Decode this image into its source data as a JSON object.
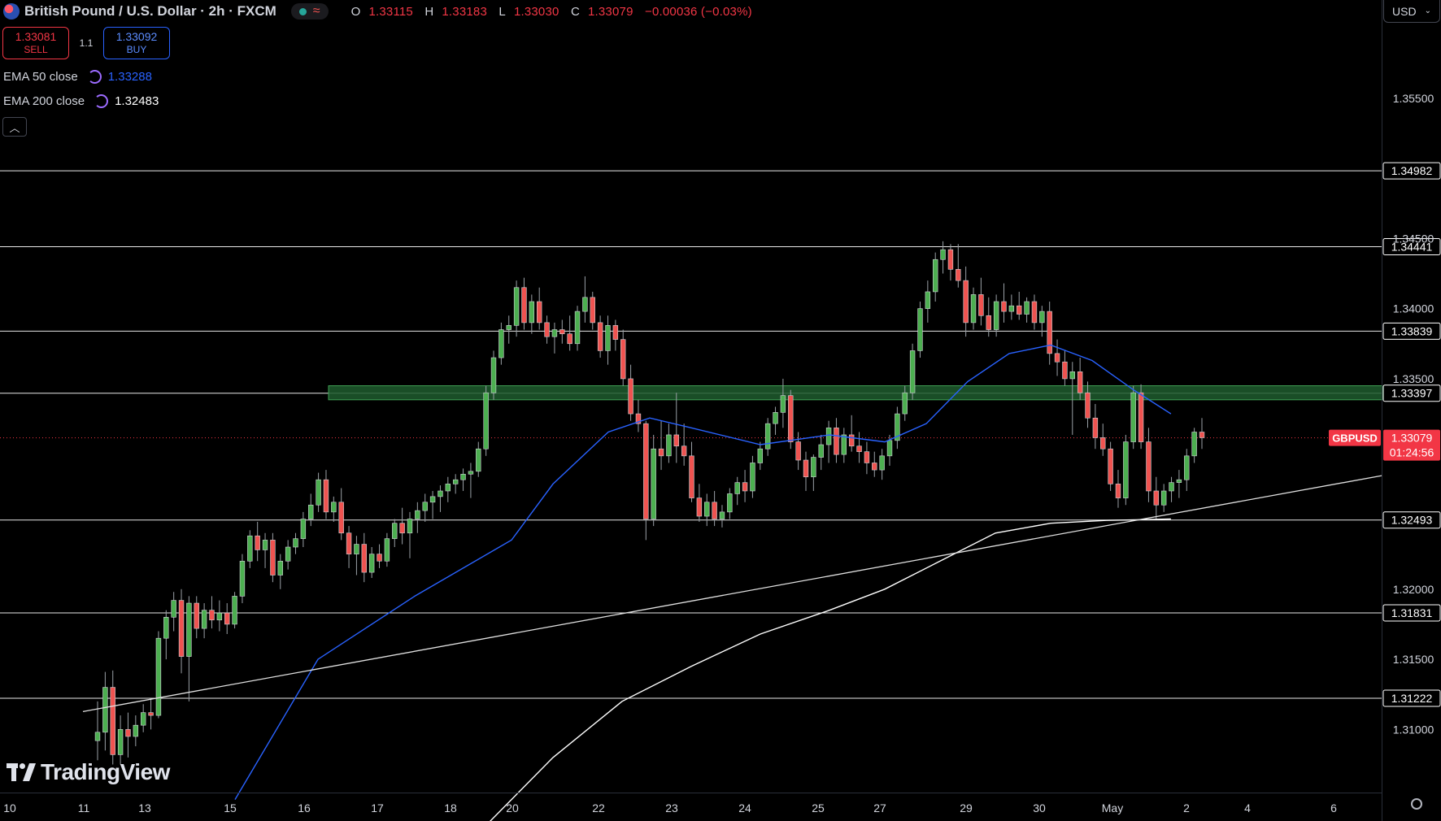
{
  "header": {
    "symbol_title": "British Pound / U.S. Dollar · 2h · FXCM",
    "open": "1.33115",
    "high": "1.33183",
    "low": "1.33030",
    "close": "1.33079",
    "change": "−0.00036 (−0.03%)"
  },
  "trade": {
    "sell_price": "1.33081",
    "sell_label": "SELL",
    "spread": "1.1",
    "buy_price": "1.33092",
    "buy_label": "BUY"
  },
  "indicators": [
    {
      "label": "EMA 50 close",
      "value": "1.33288",
      "color": "#2962ff"
    },
    {
      "label": "EMA 200 close",
      "value": "1.32483",
      "color": "#ffffff"
    }
  ],
  "currency": "USD",
  "branding": "TradingView",
  "chart_data": {
    "type": "candlestick",
    "title": "British Pound / U.S. Dollar · 2h · FXCM",
    "ylim": [
      1.3055,
      1.362
    ],
    "y_ticks": [
      "1.35500",
      "1.34500",
      "1.34000",
      "1.33500",
      "1.32000",
      "1.31500",
      "1.31000"
    ],
    "x_tick_labels": [
      "10",
      "11",
      "13",
      "15",
      "16",
      "17",
      "18",
      "20",
      "22",
      "23",
      "24",
      "25",
      "27",
      "29",
      "30",
      "May",
      "2",
      "4",
      "6"
    ],
    "horizontal_levels": [
      "1.34982",
      "1.34441",
      "1.33839",
      "1.33397",
      "1.32493",
      "1.31831",
      "1.31222"
    ],
    "current_price": {
      "symbol": "GBPUSD",
      "price": "1.33079",
      "countdown": "01:24:56",
      "value": 1.33079
    },
    "resistance_zone": [
      1.3335,
      1.3345
    ],
    "trendline": [
      [
        1.3102,
        0.0
      ],
      [
        1.3281,
        1.0
      ]
    ],
    "ema50": [
      [
        0.17,
        1.305
      ],
      [
        0.23,
        1.315
      ],
      [
        0.3,
        1.3195
      ],
      [
        0.37,
        1.3235
      ],
      [
        0.4,
        1.3275
      ],
      [
        0.44,
        1.3312
      ],
      [
        0.47,
        1.3322
      ],
      [
        0.5,
        1.3315
      ],
      [
        0.55,
        1.3303
      ],
      [
        0.6,
        1.331
      ],
      [
        0.64,
        1.3305
      ],
      [
        0.67,
        1.3318
      ],
      [
        0.7,
        1.3348
      ],
      [
        0.73,
        1.3368
      ],
      [
        0.76,
        1.3374
      ],
      [
        0.79,
        1.3363
      ],
      [
        0.82,
        1.3342
      ],
      [
        0.847,
        1.3325
      ]
    ],
    "ema200": [
      [
        0.35,
        1.303
      ],
      [
        0.4,
        1.308
      ],
      [
        0.45,
        1.312
      ],
      [
        0.5,
        1.3145
      ],
      [
        0.55,
        1.3168
      ],
      [
        0.6,
        1.3185
      ],
      [
        0.64,
        1.32
      ],
      [
        0.68,
        1.322
      ],
      [
        0.72,
        1.324
      ],
      [
        0.76,
        1.3247
      ],
      [
        0.8,
        1.3249
      ],
      [
        0.847,
        1.325
      ]
    ],
    "candles": [
      [
        1.3092,
        1.312,
        1.3078,
        1.3098
      ],
      [
        1.3098,
        1.3141,
        1.3085,
        1.313
      ],
      [
        1.313,
        1.3142,
        1.3075,
        1.3082
      ],
      [
        1.3082,
        1.311,
        1.3075,
        1.31
      ],
      [
        1.31,
        1.3112,
        1.308,
        1.3095
      ],
      [
        1.3095,
        1.311,
        1.3088,
        1.3103
      ],
      [
        1.3103,
        1.3118,
        1.3098,
        1.3112
      ],
      [
        1.3112,
        1.3122,
        1.31,
        1.311
      ],
      [
        1.311,
        1.317,
        1.3108,
        1.3165
      ],
      [
        1.3165,
        1.3185,
        1.315,
        1.318
      ],
      [
        1.318,
        1.3198,
        1.317,
        1.3192
      ],
      [
        1.3192,
        1.32,
        1.314,
        1.3152
      ],
      [
        1.3152,
        1.3195,
        1.312,
        1.319
      ],
      [
        1.319,
        1.3195,
        1.3165,
        1.3172
      ],
      [
        1.3172,
        1.319,
        1.3165,
        1.3185
      ],
      [
        1.3185,
        1.3195,
        1.3172,
        1.3178
      ],
      [
        1.3178,
        1.3192,
        1.317,
        1.3183
      ],
      [
        1.3183,
        1.319,
        1.3168,
        1.3175
      ],
      [
        1.3175,
        1.3198,
        1.3172,
        1.3195
      ],
      [
        1.3195,
        1.3225,
        1.319,
        1.322
      ],
      [
        1.322,
        1.3242,
        1.3215,
        1.3238
      ],
      [
        1.3238,
        1.3248,
        1.322,
        1.3228
      ],
      [
        1.3228,
        1.324,
        1.3215,
        1.3235
      ],
      [
        1.3235,
        1.324,
        1.3205,
        1.321
      ],
      [
        1.321,
        1.3225,
        1.32,
        1.322
      ],
      [
        1.322,
        1.3235,
        1.3214,
        1.323
      ],
      [
        1.323,
        1.324,
        1.3225,
        1.3236
      ],
      [
        1.3236,
        1.3255,
        1.323,
        1.325
      ],
      [
        1.325,
        1.3268,
        1.3245,
        1.326
      ],
      [
        1.326,
        1.3283,
        1.3255,
        1.3278
      ],
      [
        1.3278,
        1.3285,
        1.325,
        1.3255
      ],
      [
        1.3255,
        1.3266,
        1.3248,
        1.3262
      ],
      [
        1.3262,
        1.3272,
        1.3235,
        1.324
      ],
      [
        1.324,
        1.3245,
        1.3215,
        1.3225
      ],
      [
        1.3225,
        1.3238,
        1.321,
        1.3232
      ],
      [
        1.3232,
        1.324,
        1.3205,
        1.3212
      ],
      [
        1.3212,
        1.323,
        1.3208,
        1.3225
      ],
      [
        1.3225,
        1.3232,
        1.3215,
        1.322
      ],
      [
        1.322,
        1.324,
        1.3216,
        1.3236
      ],
      [
        1.3236,
        1.325,
        1.323,
        1.3247
      ],
      [
        1.3247,
        1.3258,
        1.3232,
        1.324
      ],
      [
        1.324,
        1.3255,
        1.3222,
        1.325
      ],
      [
        1.325,
        1.3262,
        1.324,
        1.3256
      ],
      [
        1.3256,
        1.3268,
        1.3248,
        1.3262
      ],
      [
        1.3262,
        1.327,
        1.325,
        1.3266
      ],
      [
        1.3266,
        1.3274,
        1.3255,
        1.327
      ],
      [
        1.327,
        1.328,
        1.3262,
        1.3275
      ],
      [
        1.3275,
        1.3282,
        1.3268,
        1.3278
      ],
      [
        1.3278,
        1.3286,
        1.327,
        1.3282
      ],
      [
        1.3282,
        1.329,
        1.3265,
        1.3284
      ],
      [
        1.3284,
        1.3305,
        1.328,
        1.33
      ],
      [
        1.33,
        1.3345,
        1.3295,
        1.334
      ],
      [
        1.334,
        1.337,
        1.3335,
        1.3365
      ],
      [
        1.3365,
        1.339,
        1.336,
        1.3385
      ],
      [
        1.3385,
        1.3395,
        1.3375,
        1.3388
      ],
      [
        1.3388,
        1.342,
        1.338,
        1.3415
      ],
      [
        1.3415,
        1.3422,
        1.3385,
        1.339
      ],
      [
        1.339,
        1.341,
        1.3382,
        1.3405
      ],
      [
        1.3405,
        1.3415,
        1.3385,
        1.339
      ],
      [
        1.339,
        1.3395,
        1.3375,
        1.338
      ],
      [
        1.338,
        1.339,
        1.3368,
        1.3385
      ],
      [
        1.3385,
        1.3392,
        1.3375,
        1.3382
      ],
      [
        1.3382,
        1.3395,
        1.337,
        1.3375
      ],
      [
        1.3375,
        1.3402,
        1.337,
        1.3398
      ],
      [
        1.3398,
        1.3423,
        1.339,
        1.3408
      ],
      [
        1.3408,
        1.3412,
        1.3385,
        1.339
      ],
      [
        1.339,
        1.3395,
        1.3365,
        1.337
      ],
      [
        1.337,
        1.3395,
        1.336,
        1.3388
      ],
      [
        1.3388,
        1.3392,
        1.337,
        1.3378
      ],
      [
        1.3378,
        1.3385,
        1.3345,
        1.335
      ],
      [
        1.335,
        1.336,
        1.332,
        1.3325
      ],
      [
        1.3325,
        1.3335,
        1.3312,
        1.3318
      ],
      [
        1.3318,
        1.332,
        1.3235,
        1.325
      ],
      [
        1.325,
        1.331,
        1.3245,
        1.33
      ],
      [
        1.33,
        1.332,
        1.3285,
        1.3295
      ],
      [
        1.3295,
        1.3318,
        1.329,
        1.331
      ],
      [
        1.331,
        1.334,
        1.329,
        1.3302
      ],
      [
        1.3302,
        1.3318,
        1.3288,
        1.3295
      ],
      [
        1.3295,
        1.3305,
        1.3262,
        1.3265
      ],
      [
        1.3265,
        1.3275,
        1.3248,
        1.3252
      ],
      [
        1.3252,
        1.3268,
        1.3245,
        1.3262
      ],
      [
        1.3262,
        1.327,
        1.3245,
        1.325
      ],
      [
        1.325,
        1.326,
        1.3244,
        1.3255
      ],
      [
        1.3255,
        1.3272,
        1.325,
        1.3268
      ],
      [
        1.3268,
        1.328,
        1.326,
        1.3276
      ],
      [
        1.3276,
        1.3285,
        1.3262,
        1.327
      ],
      [
        1.327,
        1.3295,
        1.3265,
        1.329
      ],
      [
        1.329,
        1.3305,
        1.3285,
        1.33
      ],
      [
        1.33,
        1.3322,
        1.3295,
        1.3318
      ],
      [
        1.3318,
        1.333,
        1.331,
        1.3326
      ],
      [
        1.3326,
        1.335,
        1.3315,
        1.3338
      ],
      [
        1.3338,
        1.3342,
        1.33,
        1.3305
      ],
      [
        1.3305,
        1.3312,
        1.3285,
        1.3292
      ],
      [
        1.3292,
        1.3298,
        1.327,
        1.328
      ],
      [
        1.328,
        1.3296,
        1.327,
        1.3294
      ],
      [
        1.3294,
        1.331,
        1.3285,
        1.3303
      ],
      [
        1.3303,
        1.332,
        1.329,
        1.3315
      ],
      [
        1.3315,
        1.3322,
        1.329,
        1.3296
      ],
      [
        1.3296,
        1.3315,
        1.329,
        1.331
      ],
      [
        1.331,
        1.3324,
        1.3298,
        1.3302
      ],
      [
        1.3302,
        1.3312,
        1.329,
        1.3298
      ],
      [
        1.3298,
        1.3305,
        1.3282,
        1.329
      ],
      [
        1.329,
        1.3298,
        1.328,
        1.3285
      ],
      [
        1.3285,
        1.33,
        1.3278,
        1.3295
      ],
      [
        1.3295,
        1.331,
        1.3288,
        1.3306
      ],
      [
        1.3306,
        1.333,
        1.33,
        1.3325
      ],
      [
        1.3325,
        1.3345,
        1.332,
        1.334
      ],
      [
        1.334,
        1.3375,
        1.3335,
        1.337
      ],
      [
        1.337,
        1.3405,
        1.3365,
        1.34
      ],
      [
        1.34,
        1.342,
        1.339,
        1.3412
      ],
      [
        1.3412,
        1.344,
        1.3405,
        1.3435
      ],
      [
        1.3435,
        1.3448,
        1.3425,
        1.3442
      ],
      [
        1.3442,
        1.3446,
        1.342,
        1.3428
      ],
      [
        1.3428,
        1.3446,
        1.3415,
        1.342
      ],
      [
        1.342,
        1.343,
        1.338,
        1.339
      ],
      [
        1.339,
        1.3415,
        1.3385,
        1.341
      ],
      [
        1.341,
        1.3422,
        1.3388,
        1.3395
      ],
      [
        1.3395,
        1.3408,
        1.338,
        1.3385
      ],
      [
        1.3385,
        1.341,
        1.338,
        1.3405
      ],
      [
        1.3405,
        1.3418,
        1.339,
        1.3398
      ],
      [
        1.3398,
        1.341,
        1.3392,
        1.3402
      ],
      [
        1.3402,
        1.3412,
        1.3392,
        1.3396
      ],
      [
        1.3396,
        1.3408,
        1.339,
        1.3405
      ],
      [
        1.3405,
        1.341,
        1.3385,
        1.339
      ],
      [
        1.339,
        1.3402,
        1.338,
        1.3398
      ],
      [
        1.3398,
        1.3405,
        1.336,
        1.3368
      ],
      [
        1.3368,
        1.3378,
        1.3352,
        1.3362
      ],
      [
        1.3362,
        1.337,
        1.3345,
        1.335
      ],
      [
        1.335,
        1.3362,
        1.331,
        1.3355
      ],
      [
        1.3355,
        1.3365,
        1.3335,
        1.334
      ],
      [
        1.334,
        1.3348,
        1.3315,
        1.3322
      ],
      [
        1.3322,
        1.3332,
        1.33,
        1.3308
      ],
      [
        1.3308,
        1.3318,
        1.3295,
        1.33
      ],
      [
        1.33,
        1.3305,
        1.327,
        1.3275
      ],
      [
        1.3275,
        1.3285,
        1.3258,
        1.3265
      ],
      [
        1.3265,
        1.331,
        1.326,
        1.3305
      ],
      [
        1.3305,
        1.3345,
        1.33,
        1.334
      ],
      [
        1.334,
        1.3346,
        1.33,
        1.3305
      ],
      [
        1.3305,
        1.3315,
        1.3262,
        1.327
      ],
      [
        1.327,
        1.328,
        1.325,
        1.326
      ],
      [
        1.326,
        1.3275,
        1.3255,
        1.327
      ],
      [
        1.327,
        1.328,
        1.3262,
        1.3276
      ],
      [
        1.3276,
        1.3285,
        1.3265,
        1.3278
      ],
      [
        1.3278,
        1.33,
        1.327,
        1.3295
      ],
      [
        1.3295,
        1.3315,
        1.329,
        1.3312
      ],
      [
        1.3312,
        1.3322,
        1.33,
        1.3308
      ]
    ]
  }
}
